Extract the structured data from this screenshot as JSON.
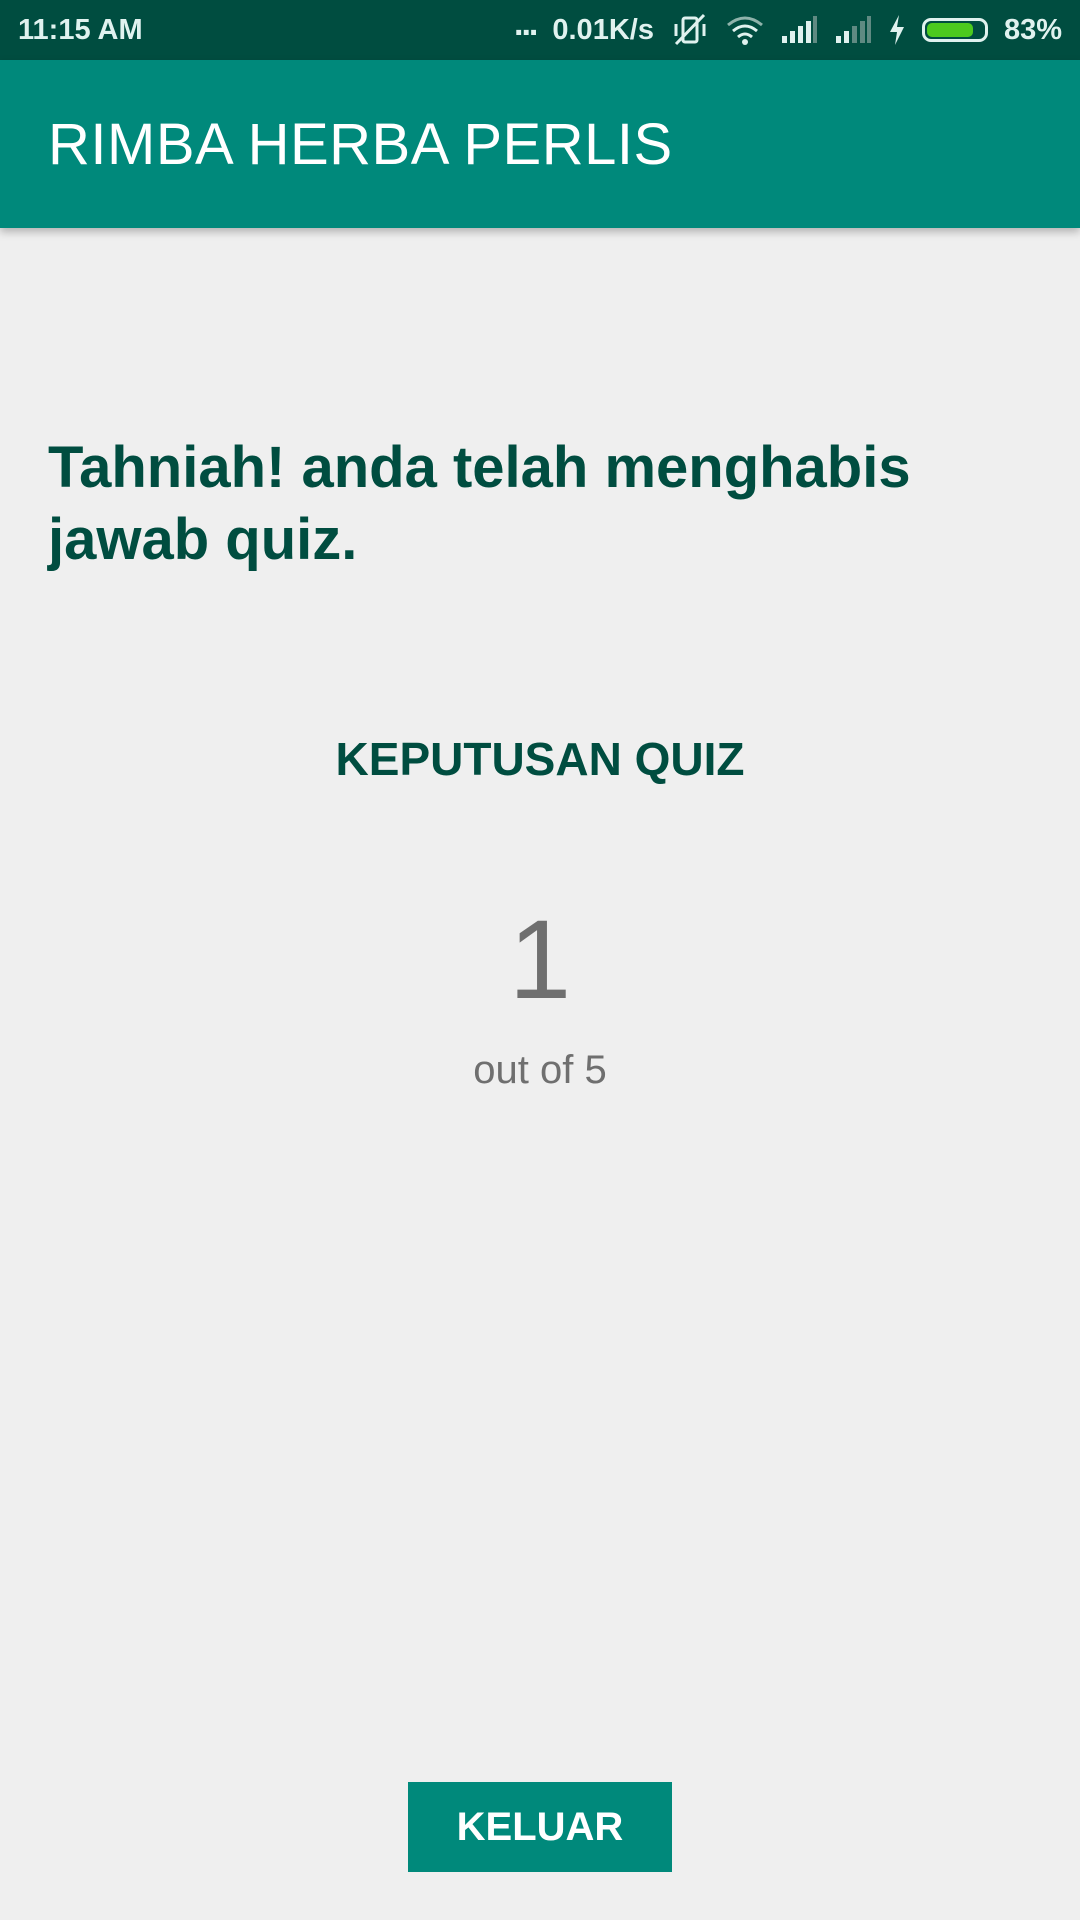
{
  "status_bar": {
    "time": "11:15 AM",
    "network_dots": "...",
    "network_speed": "0.01K/s",
    "battery_percent": "83%",
    "battery_level": 0.83,
    "battery_color": "#4cca1e",
    "icons": [
      "vibrate-off-icon",
      "wifi-icon",
      "signal-icon",
      "signal-icon",
      "charging-icon",
      "battery-icon"
    ]
  },
  "app_bar": {
    "title": "RIMBA HERBA PERLIS",
    "color": "#00897b"
  },
  "content": {
    "congrats_message": "Tahniah! anda telah menghabis jawab quiz.",
    "result_title": "KEPUTUSAN QUIZ",
    "score": "1",
    "score_total": "out of 5",
    "heading_color": "#004d40"
  },
  "actions": {
    "exit_label": "KELUAR"
  }
}
